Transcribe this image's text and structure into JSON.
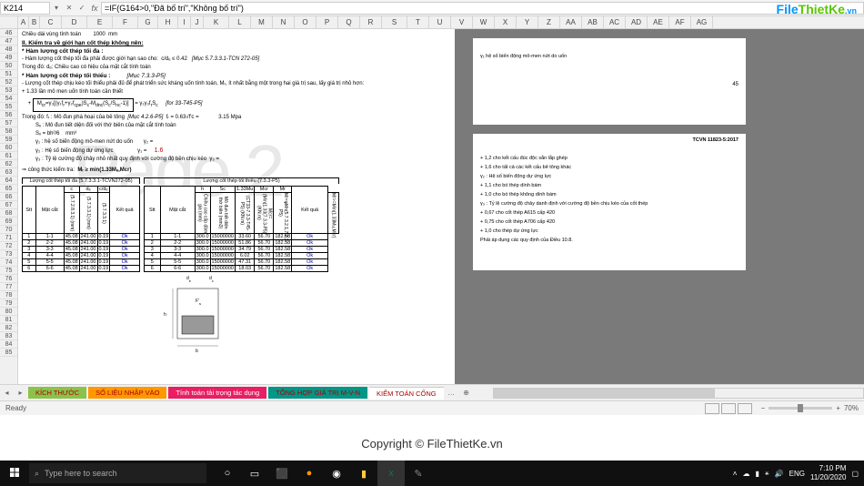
{
  "formula_bar": {
    "cell_ref": "K214",
    "formula": "=IF(G164>0,\"Đã bố trí\",\"Không bố trí\")"
  },
  "columns": [
    "A",
    "B",
    "C",
    "D",
    "E",
    "F",
    "G",
    "H",
    "I",
    "J",
    "K",
    "L",
    "M",
    "N",
    "O",
    "P",
    "Q",
    "R",
    "S",
    "T",
    "U",
    "V",
    "W",
    "X",
    "Y",
    "Z",
    "AA",
    "AB",
    "AC",
    "AD",
    "AE",
    "AF",
    "AG"
  ],
  "row_start": 46,
  "row_end": 85,
  "watermark": "Page 2",
  "logo": {
    "p1": "File",
    "p2": "ThietKe",
    "p3": ".vn"
  },
  "copyright": "Copyright © FileThietKe.vn",
  "doc": {
    "l1": "Chiều dài vùng tính toán",
    "l1v": "1000",
    "l1u": "mm",
    "h2": "II. Kiểm tra về giới hạn cốt thép không nên:",
    "b1": "* Hàm lượng cốt thép tối đa :",
    "t1": "- Hàm lượng cốt thép tối đa phải được giới hạn sao cho:",
    "eq1": "c/dₑ ≤ 0.42",
    "ref1": "[Mục 5.7.3.3.1-TCN 272-05]",
    "t2": "Trong đó:  dₑ: Chiều cao có hiệu của mặt cắt tính toán",
    "b2": "* Hàm lượng cốt thép tối thiểu :",
    "ref2": "[Mục 7.3.3-P5]",
    "t3": "- Lượng cốt thép chịu kéo tối thiểu phải đủ để phát triển sức kháng uốn tính toán, Mᵣ, ít nhất bằng một trong hai giá trị sau, lấy giá trị nhỏ hơn:",
    "t4": "+ 1.33 lần mô men uốn tính toán cần thiết",
    "ref3": "[for 33-T45-P5]",
    "t5": "Trong đó:   fᵣ : Mô đun phá hoại của bê tông",
    "ref4": "[Mục 4.2.6-P5]",
    "eq2": "fᵣ = 0.63√f'c  =",
    "v1": "3.15",
    "u1": "Mpa",
    "t6": "Sₓ : Mô đun tiết diện đối với thớ biên của mặt cắt tính toán",
    "eq3": "Sₓ = bh²/6",
    "u2": "mm³",
    "t7": "γ₁ : hệ số biến động mô-men nứt do uốn",
    "g1": "γ₂ =",
    "t8": "γ₂ : Hệ số biến động dự ứng lực",
    "g2": "γ₁ =",
    "rv": "1.6",
    "t9": "γ₃ : Tỷ lệ cường độ chảy nhỏ nhất quy định với cường độ bền chịu kéo",
    "g3": "γ₃ =",
    "concl": "⇒ công thức kiểm tra:",
    "conclf": "Mᵣ ≥ min(1.33Mᵤ,Mcr)",
    "tbl1_title": "Lượng cốt thép tối đa (5.7.3.3.1-TCVN272-05)",
    "tbl1_h": [
      "Stt",
      "Mặt cắt",
      "c",
      "dₑ",
      "c/dₑ",
      "Kết quả"
    ],
    "tbl1_sh": [
      "(5.7.2.8.3.1) (mm)",
      "(5.7.3.3.1) (mm)",
      "(5.7.3.3.1)"
    ],
    "tbl1_rows": [
      [
        "1",
        "1-1",
        "45.08",
        "241.00",
        "0.19",
        "Ok"
      ],
      [
        "2",
        "2-2",
        "45.08",
        "241.00",
        "0.19",
        "Ok"
      ],
      [
        "3",
        "3-3",
        "45.08",
        "241.00",
        "0.19",
        "Ok"
      ],
      [
        "4",
        "4-4",
        "45.08",
        "241.00",
        "0.19",
        "Ok"
      ],
      [
        "5",
        "5-5",
        "45.08",
        "241.00",
        "0.19",
        "Ok"
      ],
      [
        "6",
        "6-6",
        "45.08",
        "241.00",
        "0.19",
        "Ok"
      ]
    ],
    "tbl2_title": "Lượng cốt thép tối thiểu (7.3.3-P5)",
    "tbl2_h": [
      "Stt",
      "Mặt cắt",
      "h",
      "Sc",
      "1.33Mu",
      "Mcr",
      "Mr",
      "Kết quả"
    ],
    "tbl2_sh": [
      "Chiều cao cấp dầm gia (mm)",
      "Mô đun tiết diện thớ biên (mm3)",
      "(CT33-7.3.3-T45-P5) (KN.m)",
      "Mcr=(Min(1.33(7.3.3-P5) (KN.m)",
      "Mr=φMn(5.7.3.2.1,7.2.3-P5)",
      "Mr>=Min(1.33Mu,Mcr)"
    ],
    "tbl2_sh2": "Kiểm tra hàm lượng min",
    "tbl2_rows": [
      [
        "1",
        "1-1",
        "300.0",
        "15000000",
        "33.60",
        "56.70",
        "182.58",
        "Ok"
      ],
      [
        "2",
        "2-2",
        "300.0",
        "15000000",
        "51.86",
        "56.70",
        "182.58",
        "Ok"
      ],
      [
        "3",
        "3-3",
        "300.0",
        "15000000",
        "34.79",
        "56.70",
        "182.58",
        "Ok"
      ],
      [
        "4",
        "4-4",
        "300.0",
        "15000000",
        "6.02",
        "56.70",
        "182.58",
        "Ok"
      ],
      [
        "5",
        "5-5",
        "300.0",
        "15000000",
        "47.31",
        "56.70",
        "182.58",
        "Ok"
      ],
      [
        "6",
        "6-6",
        "300.0",
        "15000000",
        "18.03",
        "56.70",
        "182.58",
        "Ok"
      ]
    ]
  },
  "right_page": {
    "l1": "γ₁   hệ số biến động mô-men nứt do uốn",
    "page_num": "45",
    "std": "TCVN 11823-5:2017",
    "items": [
      "+ 1,2 cho kết cấu đúc độc sẵn lắp ghép",
      "+ 1,6 cho tất cả các kết cấu bê tông khác",
      "γ₂ : Hệ số biến động dự ứng lực",
      "+ 1,1 cho bó thép dính bám",
      "+ 1,0 cho bó thép không dính bám",
      "γ₃ : Tỷ lệ cường độ chảy danh định với cường độ bền chịu kéo của cốt thép",
      "+ 0,67 cho cốt thép A615 cấp 420",
      "+ 0,75 cho cốt thép A706 cấp 420",
      "+ 1,0 cho thép dự ứng lực",
      "Phải áp dụng các quy định của Điều 10.8."
    ]
  },
  "sheet_tabs": {
    "t1": "KÍCH THƯỚC",
    "t2": "SỐ LIỆU NHẬP VÀO",
    "t3": "Tính toán tải trọng tác dụng",
    "t4": "TỔNG HỢP GIÁ TRỊ M-V-N",
    "t5": "KIỂM TOÁN CỐNG"
  },
  "status_bar": {
    "ready": "Ready",
    "zoom": "70%"
  },
  "taskbar": {
    "search_ph": "Type here to search",
    "lang": "ENG",
    "time": "7:10 PM",
    "date": "11/20/2020"
  }
}
